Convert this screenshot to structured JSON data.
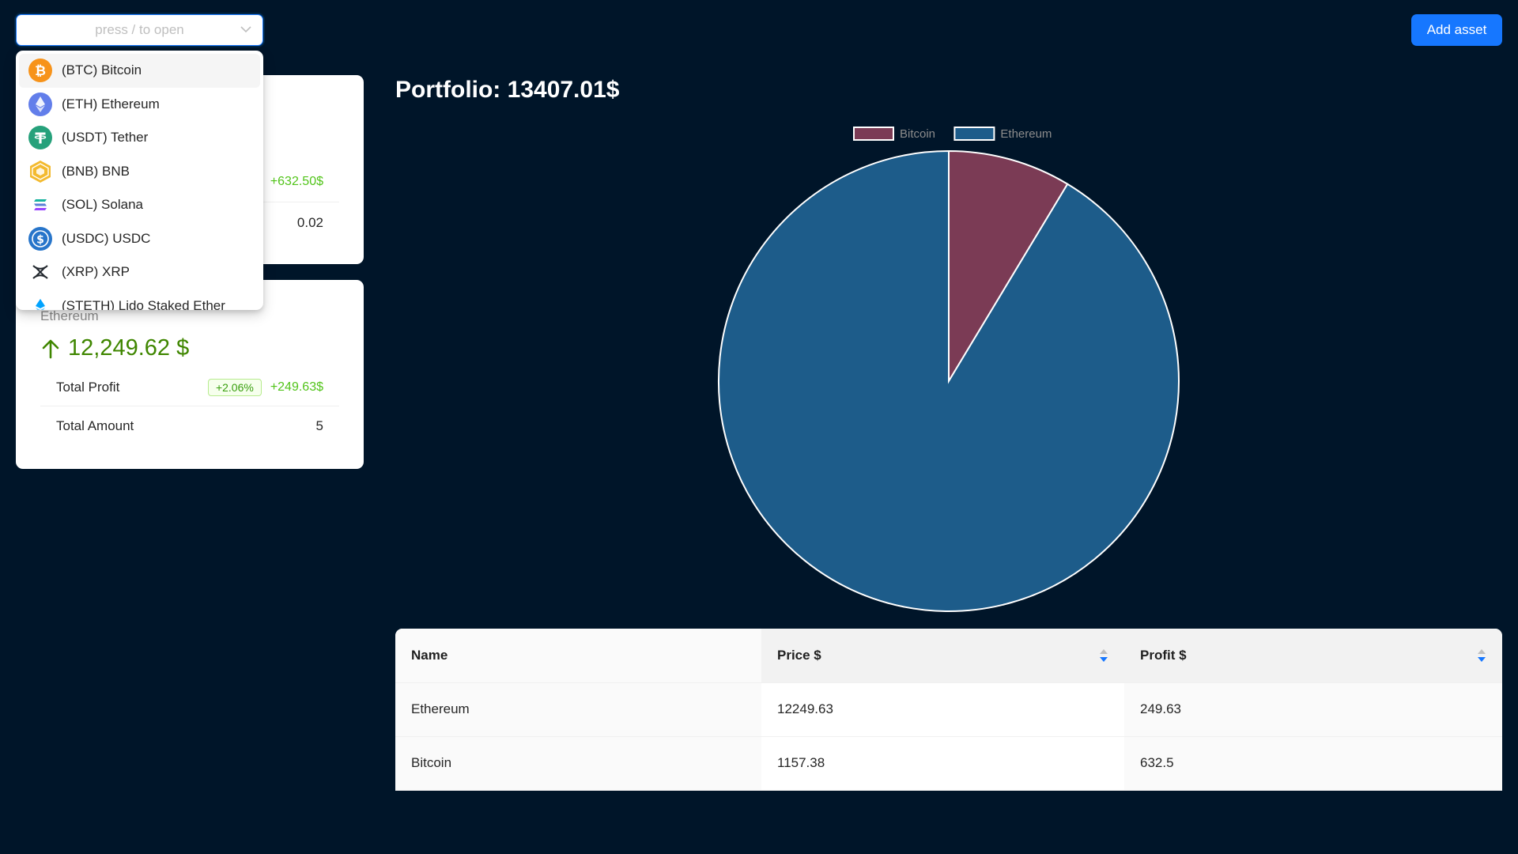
{
  "search": {
    "placeholder": "press / to open"
  },
  "dropdown": {
    "items": [
      {
        "label": "(BTC) Bitcoin",
        "icon": "bitcoin-icon",
        "color": "#f7931a"
      },
      {
        "label": "(ETH) Ethereum",
        "icon": "ethereum-icon",
        "color": "#627eea"
      },
      {
        "label": "(USDT) Tether",
        "icon": "tether-icon",
        "color": "#26a17b"
      },
      {
        "label": "(BNB) BNB",
        "icon": "bnb-icon",
        "color": "#f3ba2f"
      },
      {
        "label": "(SOL) Solana",
        "icon": "solana-icon",
        "color": "#5b7fd6"
      },
      {
        "label": "(USDC) USDC",
        "icon": "usdc-icon",
        "color": "#2775ca"
      },
      {
        "label": "(XRP) XRP",
        "icon": "xrp-icon",
        "color": "#23292f"
      },
      {
        "label": "(STETH) Lido Staked Ether",
        "icon": "steth-icon",
        "color": "#00a3ff"
      }
    ]
  },
  "card1": {
    "profit": "+632.50$",
    "amount": "0.02"
  },
  "card2": {
    "name": "Ethereum",
    "price": "12,249.62 $",
    "total_profit_label": "Total Profit",
    "profit_percent": "+2.06%",
    "profit_value": "+249.63$",
    "total_amount_label": "Total Amount",
    "amount": "5"
  },
  "header": {
    "portfolio_title": "Portfolio: 13407.01$",
    "add_button": "Add asset"
  },
  "colors": {
    "background": "#001529",
    "bitcoin_slice": "#7b3b55",
    "ethereum_slice": "#1d5c8a",
    "accent": "#1677ff",
    "positive": "#3f8600"
  },
  "chart_data": {
    "type": "pie",
    "categories": [
      "Bitcoin",
      "Ethereum"
    ],
    "values": [
      1157.38,
      12249.63
    ],
    "legend_position": "top"
  },
  "table": {
    "columns": [
      "Name",
      "Price $",
      "Profit $"
    ],
    "rows": [
      [
        "Ethereum",
        "12249.63",
        "249.63"
      ],
      [
        "Bitcoin",
        "1157.38",
        "632.5"
      ]
    ]
  }
}
